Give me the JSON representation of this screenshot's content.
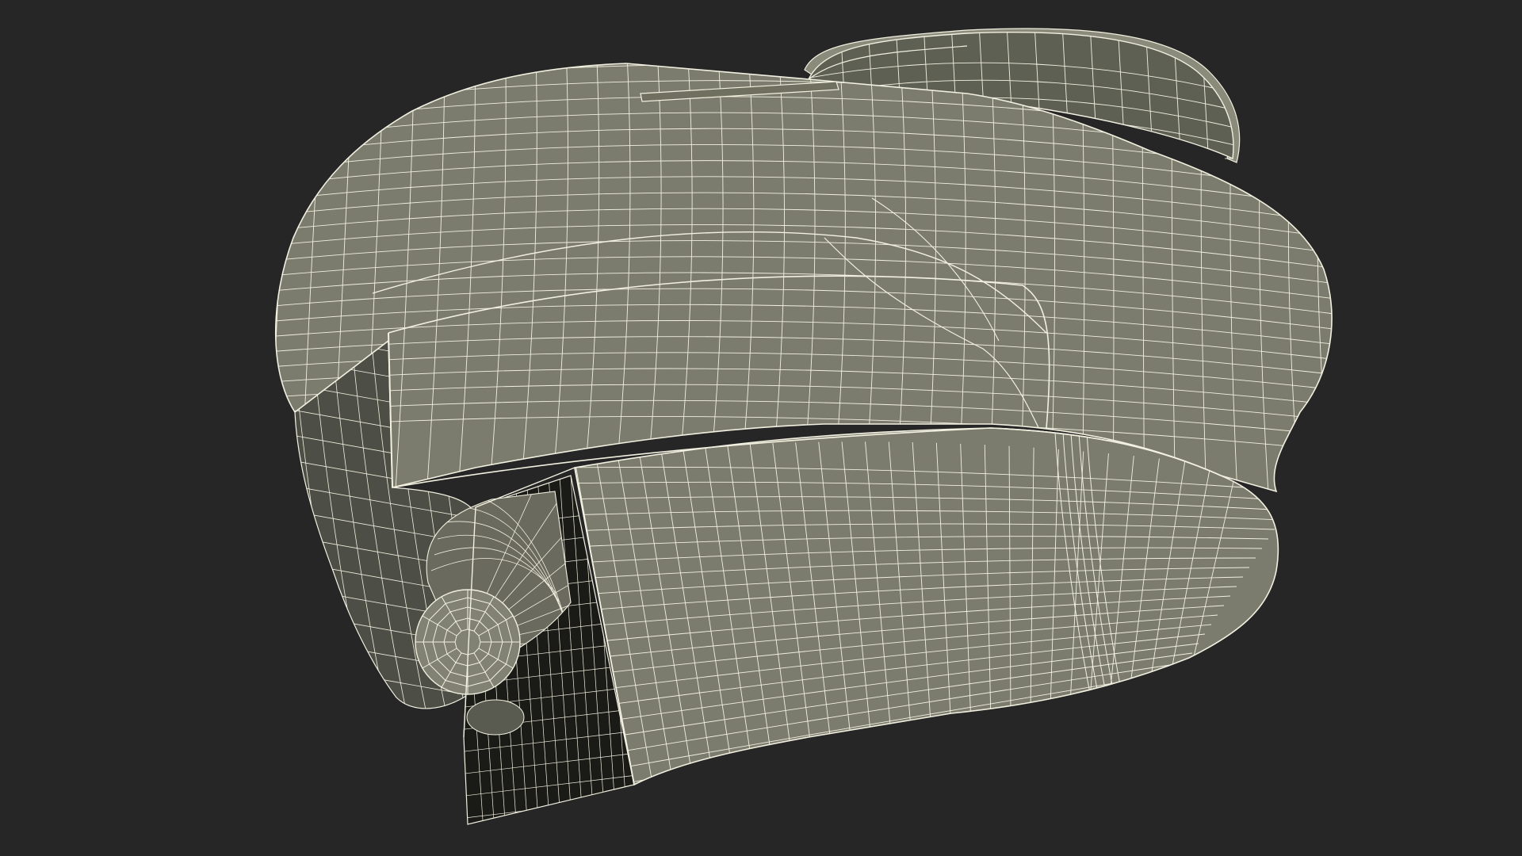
{
  "viewport": {
    "background": "#262626"
  },
  "model": {
    "description_icon": "wireframe-mesh-object",
    "surface_color": "#7b7c6d",
    "surface_dark": "#4d4e45",
    "shadow_color": "#1a1a17",
    "wire_color": "#f2f0e0"
  }
}
